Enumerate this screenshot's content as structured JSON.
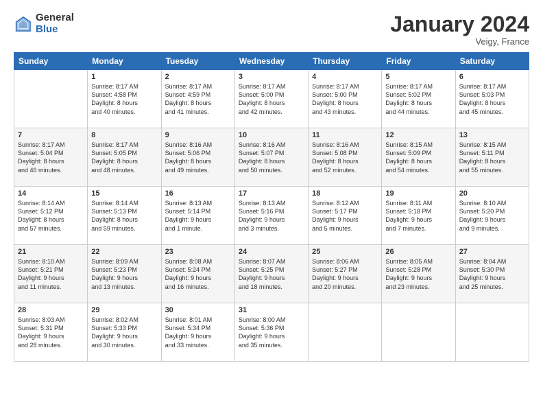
{
  "header": {
    "logo_general": "General",
    "logo_blue": "Blue",
    "month_title": "January 2024",
    "subtitle": "Veigy, France"
  },
  "weekdays": [
    "Sunday",
    "Monday",
    "Tuesday",
    "Wednesday",
    "Thursday",
    "Friday",
    "Saturday"
  ],
  "weeks": [
    [
      {
        "day": "",
        "lines": []
      },
      {
        "day": "1",
        "lines": [
          "Sunrise: 8:17 AM",
          "Sunset: 4:58 PM",
          "Daylight: 8 hours",
          "and 40 minutes."
        ]
      },
      {
        "day": "2",
        "lines": [
          "Sunrise: 8:17 AM",
          "Sunset: 4:59 PM",
          "Daylight: 8 hours",
          "and 41 minutes."
        ]
      },
      {
        "day": "3",
        "lines": [
          "Sunrise: 8:17 AM",
          "Sunset: 5:00 PM",
          "Daylight: 8 hours",
          "and 42 minutes."
        ]
      },
      {
        "day": "4",
        "lines": [
          "Sunrise: 8:17 AM",
          "Sunset: 5:00 PM",
          "Daylight: 8 hours",
          "and 43 minutes."
        ]
      },
      {
        "day": "5",
        "lines": [
          "Sunrise: 8:17 AM",
          "Sunset: 5:02 PM",
          "Daylight: 8 hours",
          "and 44 minutes."
        ]
      },
      {
        "day": "6",
        "lines": [
          "Sunrise: 8:17 AM",
          "Sunset: 5:03 PM",
          "Daylight: 8 hours",
          "and 45 minutes."
        ]
      }
    ],
    [
      {
        "day": "7",
        "lines": [
          "Sunrise: 8:17 AM",
          "Sunset: 5:04 PM",
          "Daylight: 8 hours",
          "and 46 minutes."
        ]
      },
      {
        "day": "8",
        "lines": [
          "Sunrise: 8:17 AM",
          "Sunset: 5:05 PM",
          "Daylight: 8 hours",
          "and 48 minutes."
        ]
      },
      {
        "day": "9",
        "lines": [
          "Sunrise: 8:16 AM",
          "Sunset: 5:06 PM",
          "Daylight: 8 hours",
          "and 49 minutes."
        ]
      },
      {
        "day": "10",
        "lines": [
          "Sunrise: 8:16 AM",
          "Sunset: 5:07 PM",
          "Daylight: 8 hours",
          "and 50 minutes."
        ]
      },
      {
        "day": "11",
        "lines": [
          "Sunrise: 8:16 AM",
          "Sunset: 5:08 PM",
          "Daylight: 8 hours",
          "and 52 minutes."
        ]
      },
      {
        "day": "12",
        "lines": [
          "Sunrise: 8:15 AM",
          "Sunset: 5:09 PM",
          "Daylight: 8 hours",
          "and 54 minutes."
        ]
      },
      {
        "day": "13",
        "lines": [
          "Sunrise: 8:15 AM",
          "Sunset: 5:11 PM",
          "Daylight: 8 hours",
          "and 55 minutes."
        ]
      }
    ],
    [
      {
        "day": "14",
        "lines": [
          "Sunrise: 8:14 AM",
          "Sunset: 5:12 PM",
          "Daylight: 8 hours",
          "and 57 minutes."
        ]
      },
      {
        "day": "15",
        "lines": [
          "Sunrise: 8:14 AM",
          "Sunset: 5:13 PM",
          "Daylight: 8 hours",
          "and 59 minutes."
        ]
      },
      {
        "day": "16",
        "lines": [
          "Sunrise: 8:13 AM",
          "Sunset: 5:14 PM",
          "Daylight: 9 hours",
          "and 1 minute."
        ]
      },
      {
        "day": "17",
        "lines": [
          "Sunrise: 8:13 AM",
          "Sunset: 5:16 PM",
          "Daylight: 9 hours",
          "and 3 minutes."
        ]
      },
      {
        "day": "18",
        "lines": [
          "Sunrise: 8:12 AM",
          "Sunset: 5:17 PM",
          "Daylight: 9 hours",
          "and 5 minutes."
        ]
      },
      {
        "day": "19",
        "lines": [
          "Sunrise: 8:11 AM",
          "Sunset: 5:18 PM",
          "Daylight: 9 hours",
          "and 7 minutes."
        ]
      },
      {
        "day": "20",
        "lines": [
          "Sunrise: 8:10 AM",
          "Sunset: 5:20 PM",
          "Daylight: 9 hours",
          "and 9 minutes."
        ]
      }
    ],
    [
      {
        "day": "21",
        "lines": [
          "Sunrise: 8:10 AM",
          "Sunset: 5:21 PM",
          "Daylight: 9 hours",
          "and 11 minutes."
        ]
      },
      {
        "day": "22",
        "lines": [
          "Sunrise: 8:09 AM",
          "Sunset: 5:23 PM",
          "Daylight: 9 hours",
          "and 13 minutes."
        ]
      },
      {
        "day": "23",
        "lines": [
          "Sunrise: 8:08 AM",
          "Sunset: 5:24 PM",
          "Daylight: 9 hours",
          "and 16 minutes."
        ]
      },
      {
        "day": "24",
        "lines": [
          "Sunrise: 8:07 AM",
          "Sunset: 5:25 PM",
          "Daylight: 9 hours",
          "and 18 minutes."
        ]
      },
      {
        "day": "25",
        "lines": [
          "Sunrise: 8:06 AM",
          "Sunset: 5:27 PM",
          "Daylight: 9 hours",
          "and 20 minutes."
        ]
      },
      {
        "day": "26",
        "lines": [
          "Sunrise: 8:05 AM",
          "Sunset: 5:28 PM",
          "Daylight: 9 hours",
          "and 23 minutes."
        ]
      },
      {
        "day": "27",
        "lines": [
          "Sunrise: 8:04 AM",
          "Sunset: 5:30 PM",
          "Daylight: 9 hours",
          "and 25 minutes."
        ]
      }
    ],
    [
      {
        "day": "28",
        "lines": [
          "Sunrise: 8:03 AM",
          "Sunset: 5:31 PM",
          "Daylight: 9 hours",
          "and 28 minutes."
        ]
      },
      {
        "day": "29",
        "lines": [
          "Sunrise: 8:02 AM",
          "Sunset: 5:33 PM",
          "Daylight: 9 hours",
          "and 30 minutes."
        ]
      },
      {
        "day": "30",
        "lines": [
          "Sunrise: 8:01 AM",
          "Sunset: 5:34 PM",
          "Daylight: 9 hours",
          "and 33 minutes."
        ]
      },
      {
        "day": "31",
        "lines": [
          "Sunrise: 8:00 AM",
          "Sunset: 5:36 PM",
          "Daylight: 9 hours",
          "and 35 minutes."
        ]
      },
      {
        "day": "",
        "lines": []
      },
      {
        "day": "",
        "lines": []
      },
      {
        "day": "",
        "lines": []
      }
    ]
  ]
}
